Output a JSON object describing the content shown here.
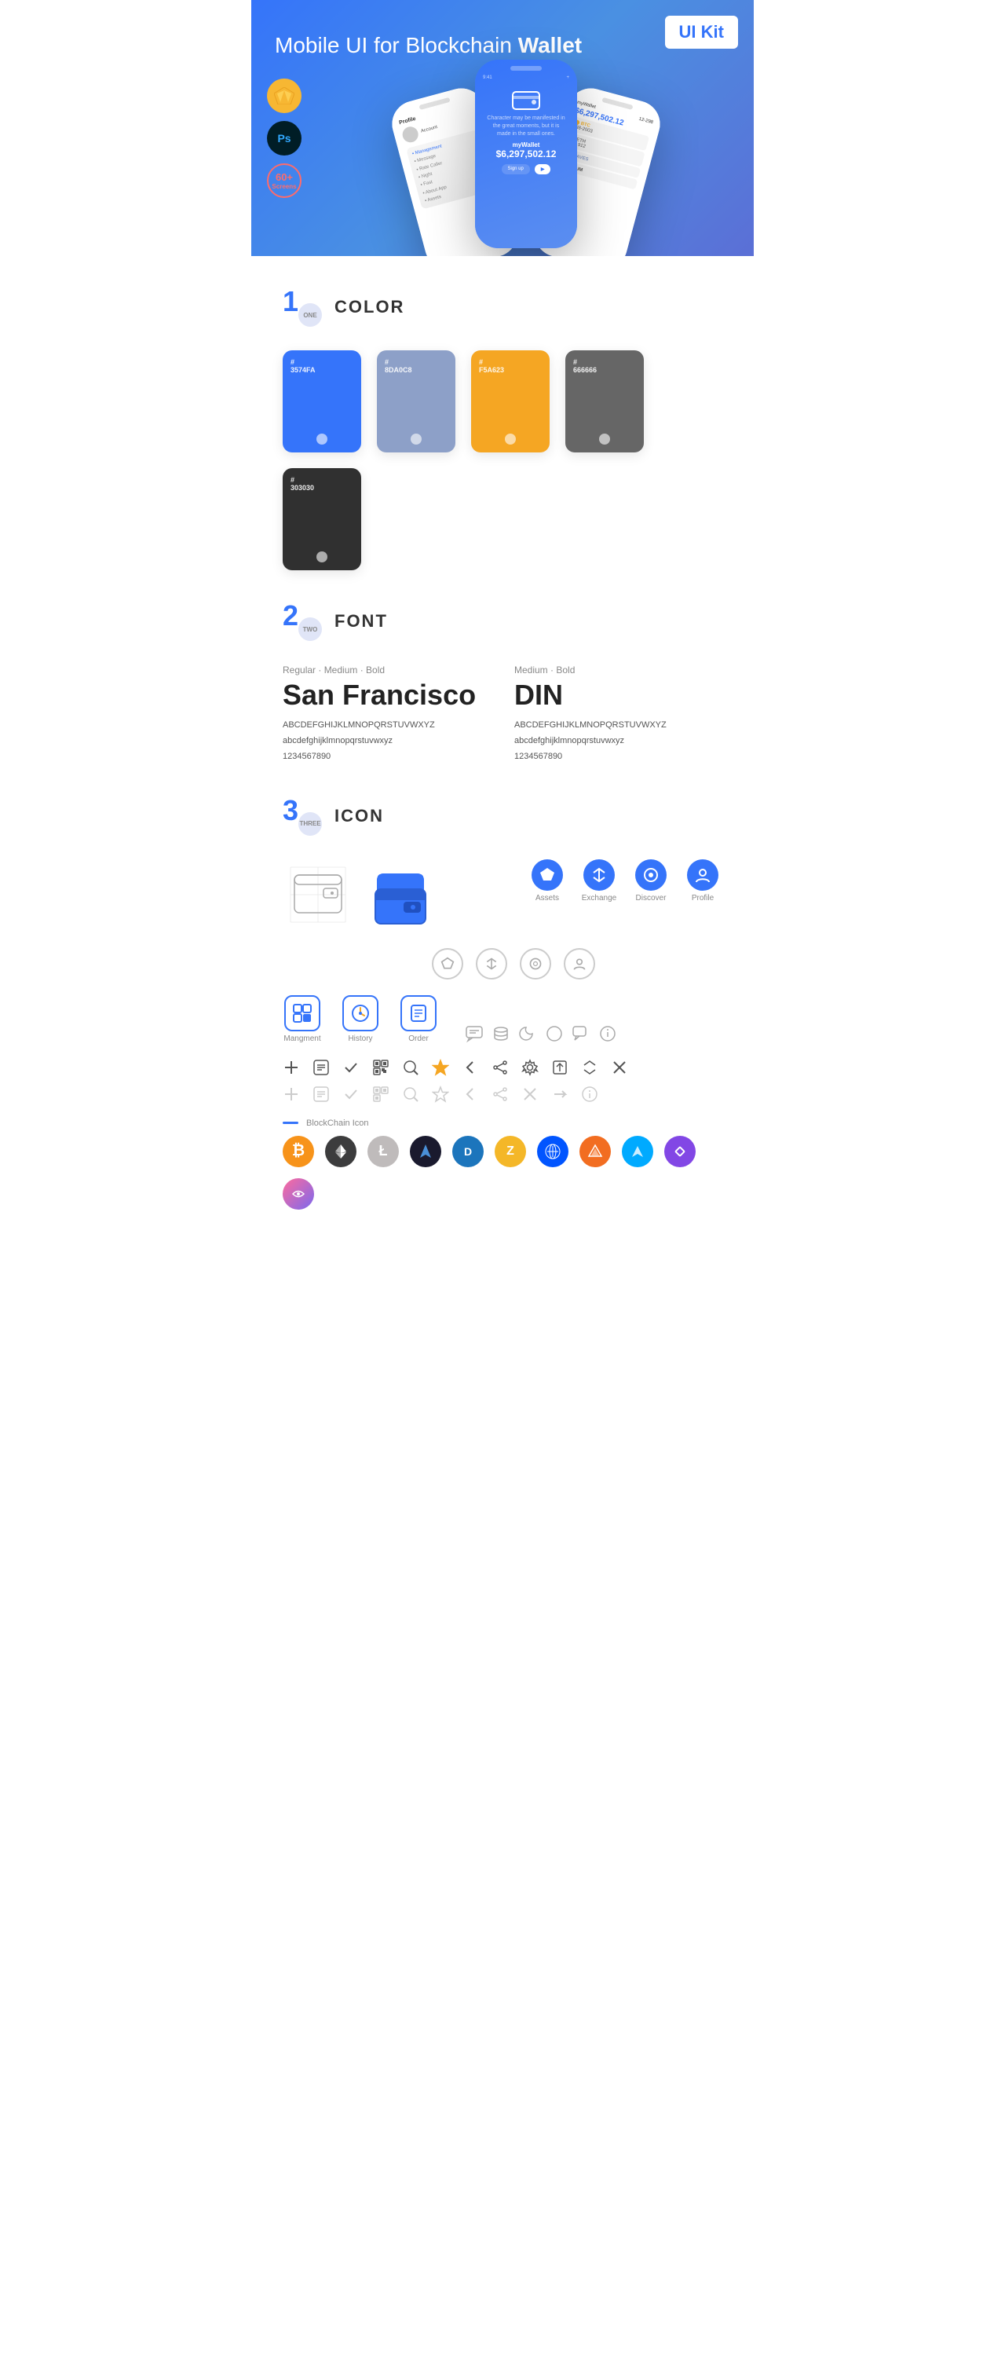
{
  "hero": {
    "title": "Mobile UI for Blockchain ",
    "title_bold": "Wallet",
    "badge": "UI Kit",
    "sketch_label": "Sk",
    "ps_label": "Ps",
    "screens_count": "60+",
    "screens_label": "Screens"
  },
  "sections": {
    "color": {
      "number": "1",
      "sublabel": "ONE",
      "title": "COLOR",
      "swatches": [
        {
          "hex": "#3574FA",
          "label": "3574FA"
        },
        {
          "hex": "#8DA0C8",
          "label": "8DA0C8"
        },
        {
          "hex": "#F5A623",
          "label": "F5A623"
        },
        {
          "hex": "#666666",
          "label": "666666"
        },
        {
          "hex": "#303030",
          "label": "303030"
        }
      ]
    },
    "font": {
      "number": "2",
      "sublabel": "TWO",
      "title": "FONT",
      "font1": {
        "label": "Regular · Medium · Bold",
        "name": "San Francisco",
        "uppercase": "ABCDEFGHIJKLMNOPQRSTUVWXYZ",
        "lowercase": "abcdefghijklmnopqrstuvwxyz",
        "numbers": "1234567890"
      },
      "font2": {
        "label": "Medium · Bold",
        "name": "DIN",
        "uppercase": "ABCDEFGHIJKLMNOPQRSTUVWXYZ",
        "lowercase": "abcdefghijklmnopqrstuvwxyz",
        "numbers": "1234567890"
      }
    },
    "icon": {
      "number": "3",
      "sublabel": "THREE",
      "title": "ICON",
      "nav_labels": [
        "Assets",
        "Exchange",
        "Discover",
        "Profile"
      ],
      "bottom_labels": [
        "Mangment",
        "History",
        "Order"
      ],
      "blockchain_label": "BlockChain Icon"
    }
  }
}
